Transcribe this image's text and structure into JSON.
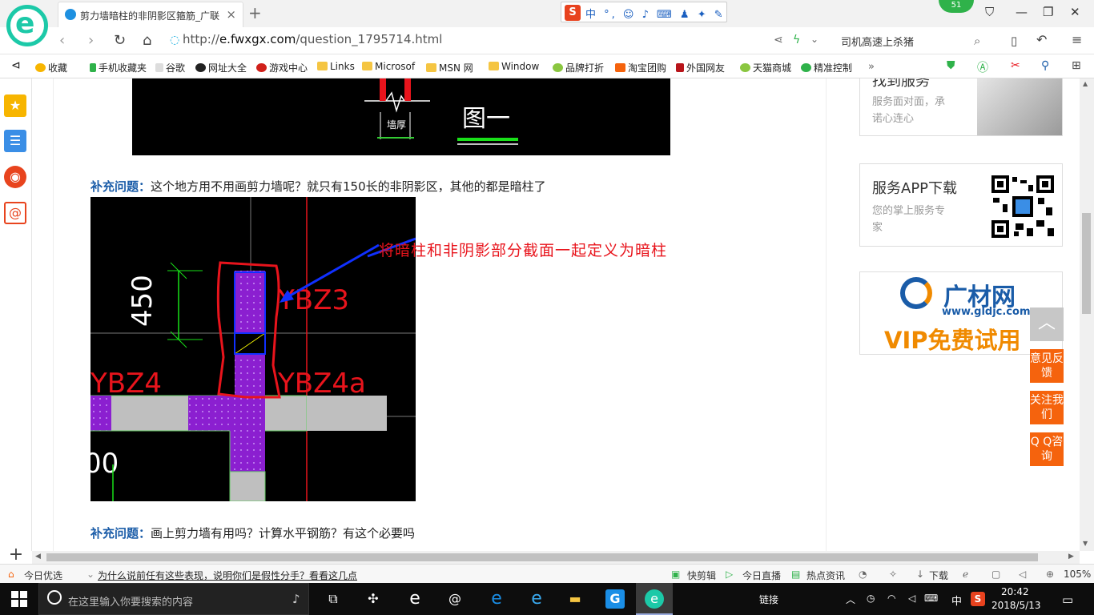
{
  "tab": {
    "title": "剪力墙暗柱的非阴影区箍筋_广联",
    "close": "×",
    "new_tab": "+"
  },
  "ime": {
    "logo": "S",
    "text": "中 °, ☺ ♪ ⌨ ♟ ✦ ✎"
  },
  "notification_badge": "51",
  "address": {
    "prefix": "http://",
    "domain": "e.fwxgx.com",
    "path": "/question_1795714.html"
  },
  "search_box": {
    "text": "司机高速上杀猪"
  },
  "bookmarks": [
    {
      "label": "收藏",
      "icon": "star-icon"
    },
    {
      "label": "手机收藏夹",
      "icon": "phone-icon"
    },
    {
      "label": "谷歌",
      "icon": "page-icon"
    },
    {
      "label": "网址大全",
      "icon": "globe-icon"
    },
    {
      "label": "游戏中心",
      "icon": "game-icon"
    },
    {
      "label": "Links",
      "icon": "folder-icon"
    },
    {
      "label": "Microsof",
      "icon": "folder-icon"
    },
    {
      "label": "MSN 网",
      "icon": "folder-icon"
    },
    {
      "label": "Window",
      "icon": "folder-icon"
    },
    {
      "label": "品牌打折",
      "icon": "leaf-icon"
    },
    {
      "label": "淘宝团购",
      "icon": "taobao-icon"
    },
    {
      "label": "外国网友",
      "icon": "flag-icon"
    },
    {
      "label": "天猫商城",
      "icon": "leaf-icon"
    },
    {
      "label": "精准控制",
      "icon": "chat-icon"
    }
  ],
  "content": {
    "img1_label_wall": "墙厚",
    "img1_label_fig": "图一",
    "q1_tag": "补充问题：",
    "q1_text": "这个地方用不用画剪力墙呢？就只有150长的非阴影区，其他的都是暗柱了",
    "cad": {
      "dim": "450",
      "ybz3": "YBZ3",
      "ybz4": "YBZ4",
      "ybz4a": "YBZ4a",
      "zero": "00"
    },
    "annotation": "将暗柱和非阴影部分截面一起定义为暗柱",
    "q2_tag": "补充问题：",
    "q2_text": "画上剪力墙有用吗？计算水平钢筋？有这个必要吗"
  },
  "right": {
    "box1_title": "找到服务",
    "box1_sub1": "服务面对面，承",
    "box1_sub2": "诺心连心",
    "box2_title": "服务APP下载",
    "box2_sub1": "您的掌上服务专",
    "box2_sub2": "家",
    "ad_brand": "广材网",
    "ad_url": "www.gldjc.com",
    "ad_vip": "VIP免费试用"
  },
  "float": {
    "top": "︿",
    "feedback": "意见反馈",
    "follow": "关注我们",
    "qq": "Q Q咨询"
  },
  "status": {
    "today": "今日优选",
    "news": "为什么说前任有这些表现，说明你们是假性分手？看看这几点",
    "clip": "快剪辑",
    "live": "今日直播",
    "hot": "热点资讯",
    "download": "下载",
    "zoom": "105%"
  },
  "taskbar": {
    "search_placeholder": "在这里输入你要搜索的内容",
    "link": "链接",
    "ime": "中",
    "time": "20:42",
    "date": "2018/5/13"
  }
}
